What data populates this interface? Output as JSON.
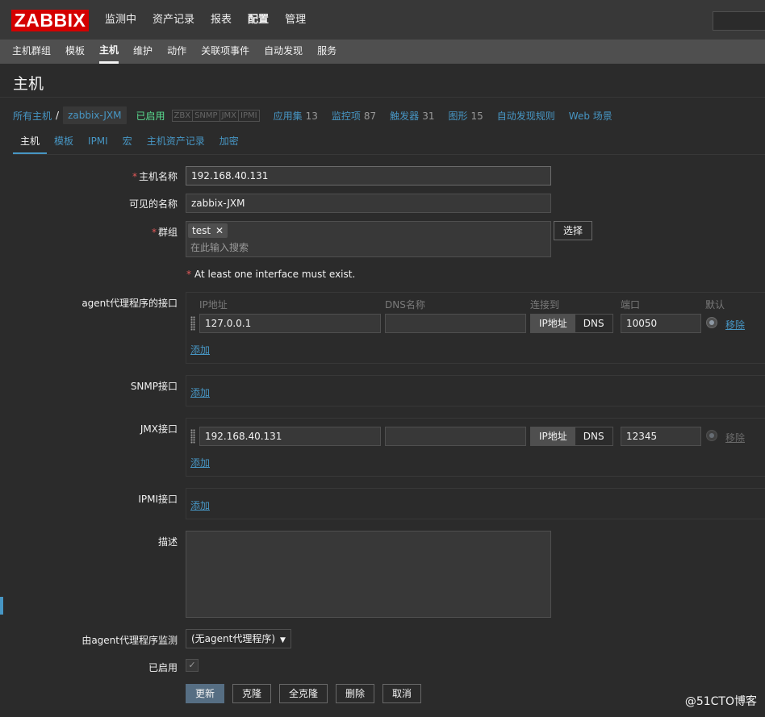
{
  "app": {
    "logo": "ZABBIX"
  },
  "topmenu": [
    {
      "label": "监测中"
    },
    {
      "label": "资产记录"
    },
    {
      "label": "报表"
    },
    {
      "label": "配置"
    },
    {
      "label": "管理"
    }
  ],
  "submenu": [
    {
      "label": "主机群组"
    },
    {
      "label": "模板"
    },
    {
      "label": "主机"
    },
    {
      "label": "维护"
    },
    {
      "label": "动作"
    },
    {
      "label": "关联项事件"
    },
    {
      "label": "自动发现"
    },
    {
      "label": "服务"
    }
  ],
  "page": {
    "title": "主机"
  },
  "breadcrumb": {
    "all_hosts": "所有主机",
    "separator": "/",
    "current": "zabbix-JXM",
    "status": "已启用",
    "availability": [
      "ZBX",
      "SNMP",
      "JMX",
      "IPMI"
    ],
    "items": [
      {
        "label": "应用集",
        "count": "13"
      },
      {
        "label": "监控项",
        "count": "87"
      },
      {
        "label": "触发器",
        "count": "31"
      },
      {
        "label": "图形",
        "count": "15"
      },
      {
        "label": "自动发现规则",
        "count": ""
      },
      {
        "label": "Web 场景",
        "count": ""
      }
    ]
  },
  "tabs": [
    {
      "label": "主机"
    },
    {
      "label": "模板"
    },
    {
      "label": "IPMI"
    },
    {
      "label": "宏"
    },
    {
      "label": "主机资产记录"
    },
    {
      "label": "加密"
    }
  ],
  "form": {
    "hostname_label": "主机名称",
    "hostname_value": "192.168.40.131",
    "visible_label": "可见的名称",
    "visible_value": "zabbix-JXM",
    "groups_label": "群组",
    "group_tag": "test",
    "group_remove": "✕",
    "groups_placeholder": "在此输入搜索",
    "select_button": "选择",
    "required_star": "*",
    "interface_error": "At least one interface must exist.",
    "interface_columns": {
      "ip": "IP地址",
      "dns": "DNS名称",
      "connect": "连接到",
      "port": "端口",
      "default": "默认"
    },
    "agent_label": "agent代理程序的接口",
    "agent_ip": "127.0.0.1",
    "agent_dns": "",
    "agent_port": "10050",
    "connect_ip": "IP地址",
    "connect_dns": "DNS",
    "remove": "移除",
    "add": "添加",
    "snmp_label": "SNMP接口",
    "jmx_label": "JMX接口",
    "jmx_ip": "192.168.40.131",
    "jmx_dns": "",
    "jmx_port": "12345",
    "ipmi_label": "IPMI接口",
    "description_label": "描述",
    "description_value": "",
    "proxy_label": "由agent代理程序监测",
    "proxy_value": "(无agent代理程序)",
    "proxy_arrow": "▼",
    "enabled_label": "已启用",
    "enabled_check": "✓"
  },
  "buttons": {
    "update": "更新",
    "clone": "克隆",
    "full_clone": "全克隆",
    "delete": "删除",
    "cancel": "取消"
  },
  "watermark": "@51CTO博客"
}
